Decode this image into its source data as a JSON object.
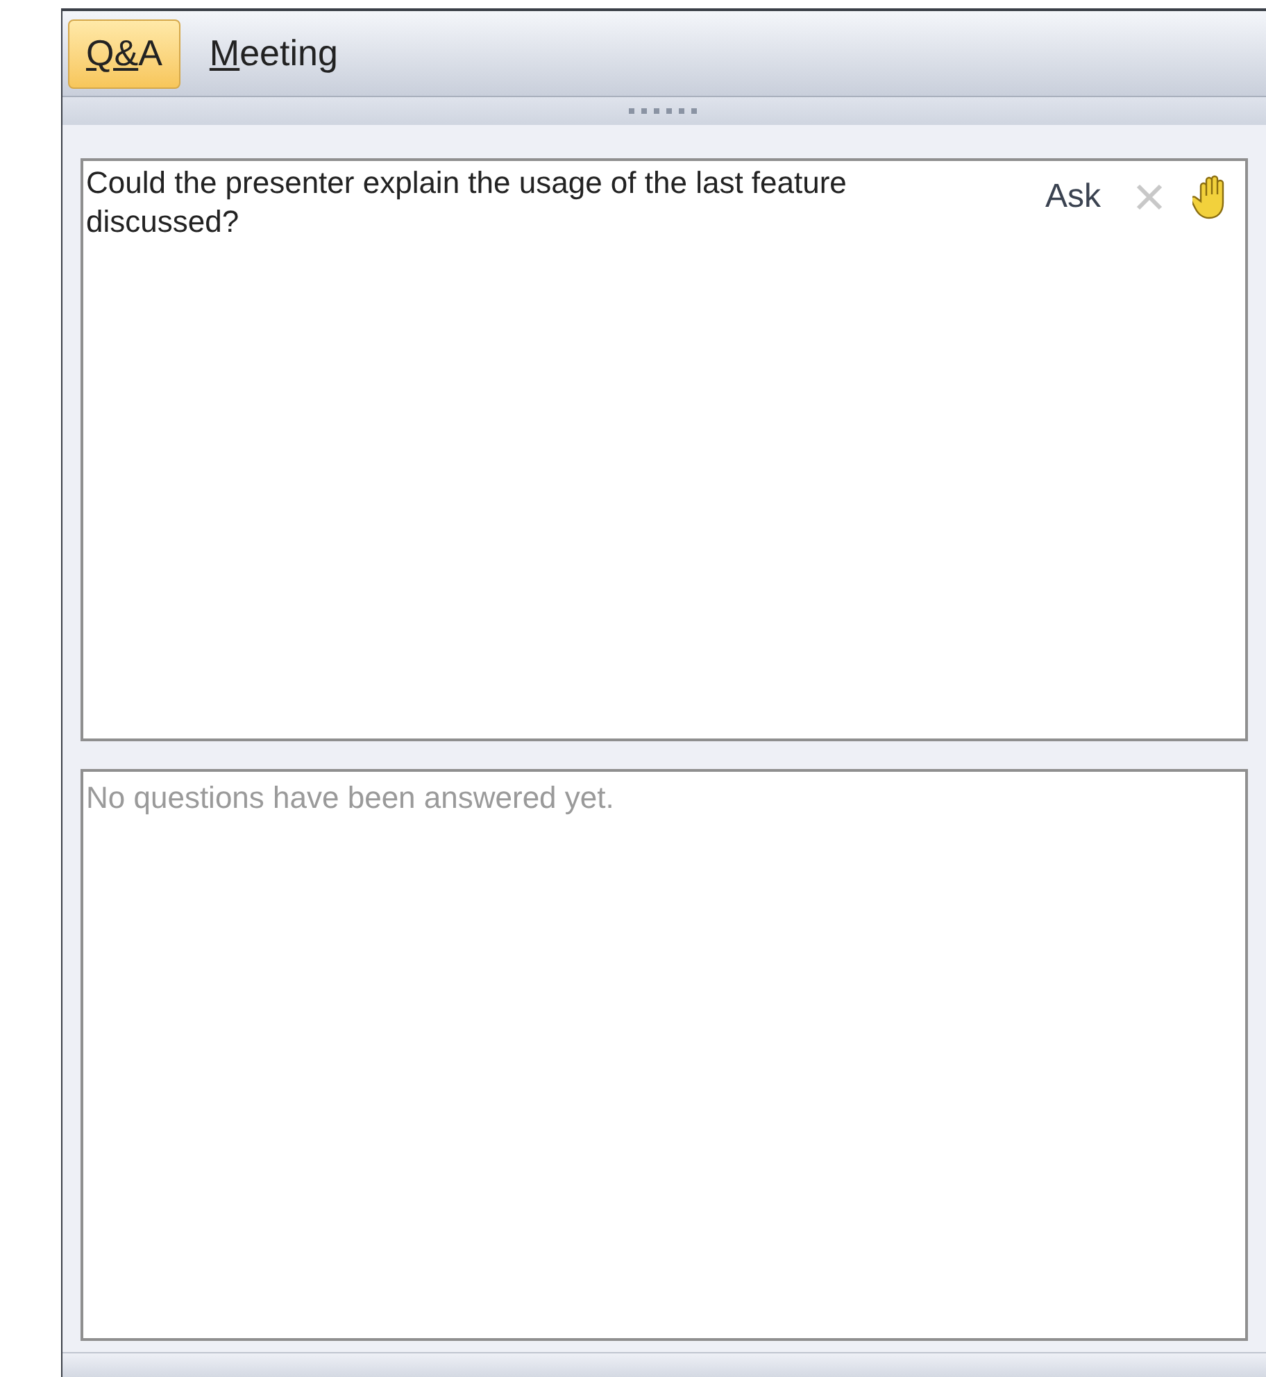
{
  "tabs": [
    {
      "label": "Q&A",
      "selected": true
    },
    {
      "label": "Meeting",
      "selected": false
    }
  ],
  "question": {
    "value": "Could the presenter explain the usage of the last feature discussed?",
    "ask_label": "Ask"
  },
  "answered": {
    "message": "No questions have been answered yet."
  }
}
